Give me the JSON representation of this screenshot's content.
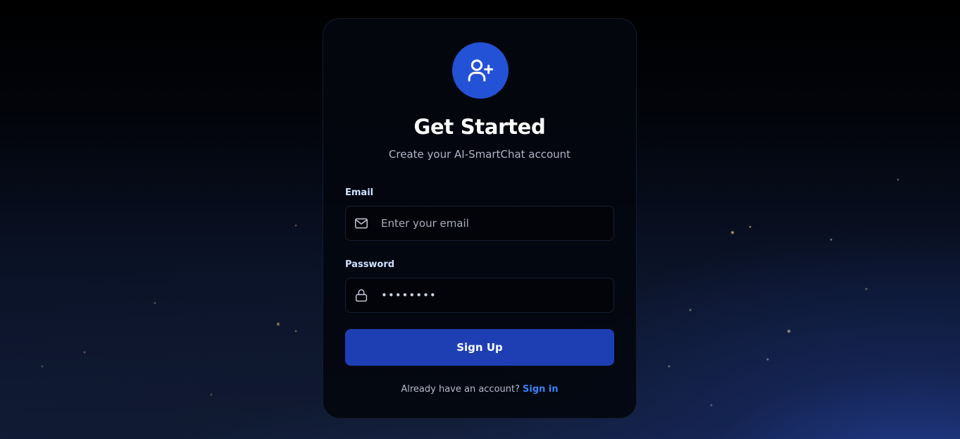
{
  "page": {
    "title": "Get Started",
    "subtitle": "Create your AI-SmartChat account"
  },
  "form": {
    "email": {
      "label": "Email",
      "placeholder": "Enter your email",
      "value": ""
    },
    "password": {
      "label": "Password",
      "value": "••••••••"
    },
    "submit_label": "Sign Up"
  },
  "footer": {
    "prompt": "Already have an account?",
    "link_label": "Sign in"
  },
  "icons": {
    "header": "user-plus-icon",
    "email": "mail-icon",
    "password": "lock-icon"
  },
  "colors": {
    "accent": "#2452d6",
    "button": "#1e3fb4",
    "link": "#3b82f6"
  }
}
